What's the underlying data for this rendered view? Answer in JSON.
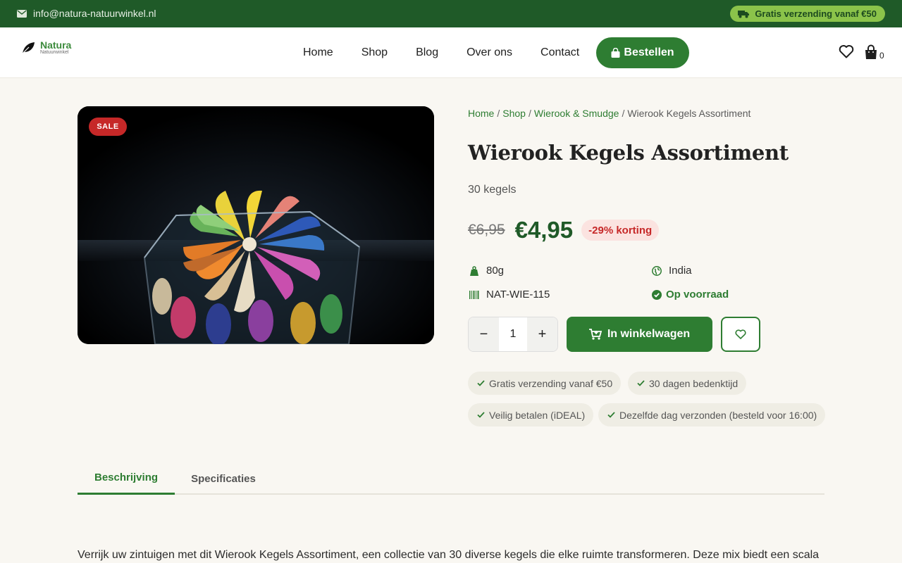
{
  "topbar": {
    "email": "info@natura-natuurwinkel.nl",
    "shipping": "Gratis verzending vanaf €50"
  },
  "header": {
    "logo_name": "Natura",
    "logo_sub": "Natuurwinkel",
    "nav": [
      "Home",
      "Shop",
      "Blog",
      "Over ons",
      "Contact"
    ],
    "order_button": "Bestellen",
    "cart_count": "0"
  },
  "product": {
    "badge": "SALE",
    "breadcrumb": [
      "Home",
      "Shop",
      "Wierook & Smudge",
      "Wierook Kegels Assortiment"
    ],
    "title": "Wierook Kegels Assortiment",
    "quantity_text": "30 kegels",
    "old_price": "€6,95",
    "price": "€4,95",
    "discount": "-29% korting",
    "weight": "80g",
    "origin": "India",
    "sku": "NAT-WIE-115",
    "stock": "Op voorraad",
    "qty_minus": "−",
    "qty_value": "1",
    "qty_plus": "+",
    "add_to_cart": "In winkelwagen",
    "perks": [
      "Gratis verzending vanaf €50",
      "30 dagen bedenktijd",
      "Veilig betalen (iDEAL)",
      "Dezelfde dag verzonden (besteld voor 16:00)"
    ]
  },
  "tabs": [
    "Beschrijving",
    "Specificaties"
  ],
  "description": "Verrijk uw zintuigen met dit Wierook Kegels Assortiment, een collectie van 30 diverse kegels die elke ruimte transformeren. Deze mix biedt een scala",
  "colors": {
    "brand_green": "#2e7d32",
    "dark_green": "#1f5a28",
    "accent_green": "#8bc34a",
    "sale_red": "#c62828",
    "background": "#f9f7f2"
  },
  "icons": {
    "email": "envelope-icon",
    "shipping": "truck-icon",
    "logo": "leaf-icon",
    "wishlist": "heart-icon",
    "cart": "shopping-bag-icon",
    "weight": "weight-icon",
    "origin": "globe-icon",
    "sku": "barcode-icon",
    "stock": "check-circle-icon",
    "add_to_cart": "cart-plus-icon",
    "perk": "check-icon"
  }
}
